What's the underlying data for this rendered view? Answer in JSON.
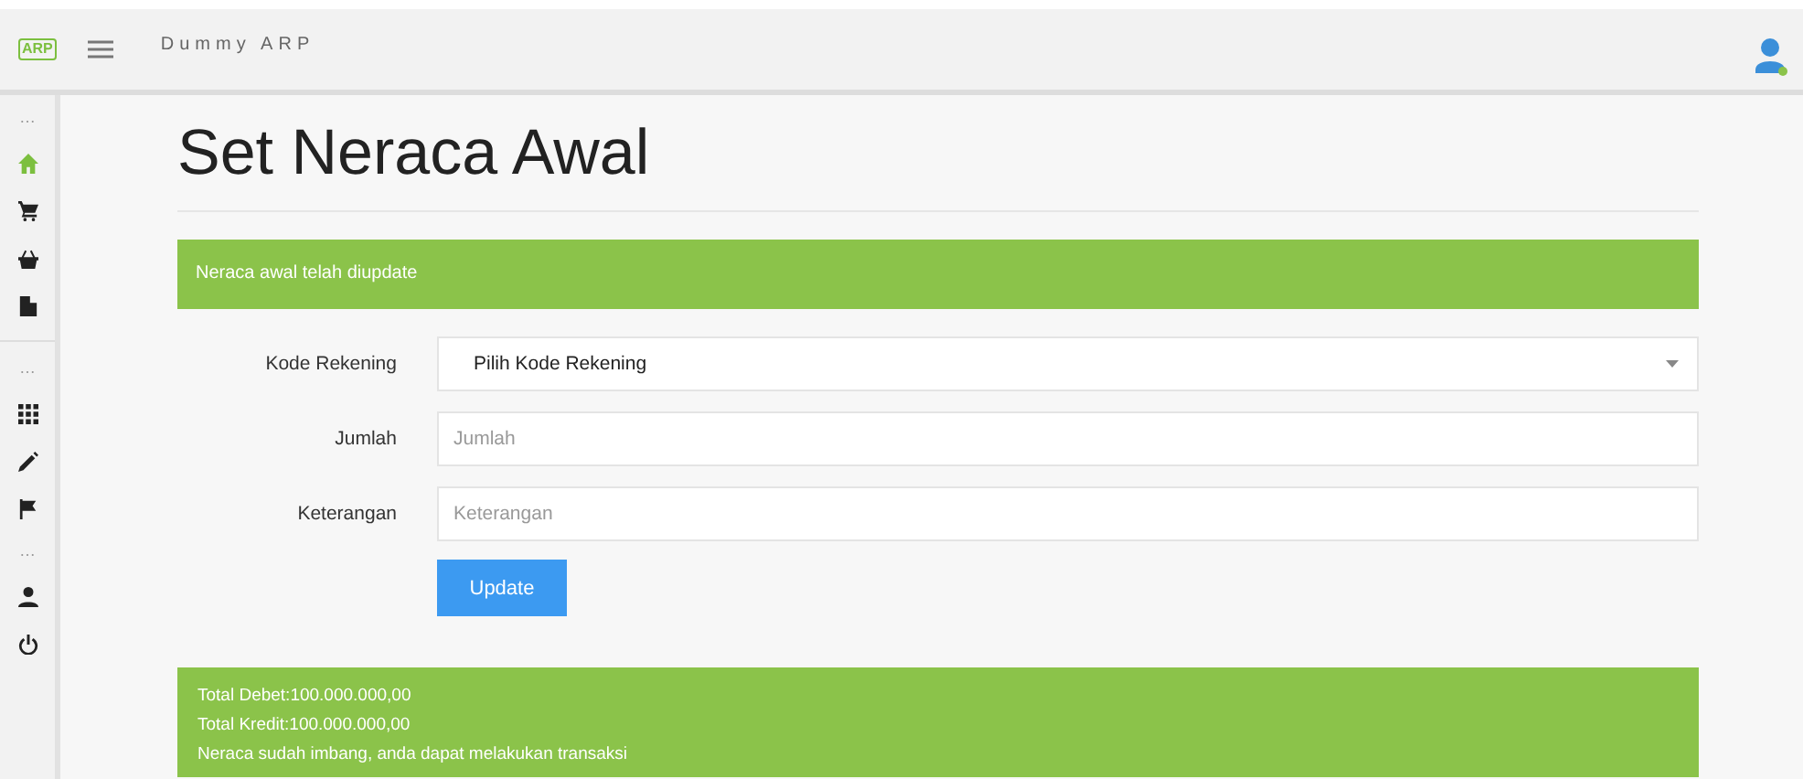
{
  "header": {
    "logo_text": "ARP",
    "app_name": "Dummy ARP",
    "user_online": true
  },
  "sidebar": {
    "items": [
      {
        "kind": "dots",
        "label": "…"
      },
      {
        "kind": "home",
        "selected": true
      },
      {
        "kind": "cart",
        "selected": false
      },
      {
        "kind": "basket",
        "selected": false
      },
      {
        "kind": "file",
        "selected": false
      },
      {
        "kind": "divider"
      },
      {
        "kind": "dots",
        "label": "…"
      },
      {
        "kind": "grid",
        "selected": false
      },
      {
        "kind": "pencil",
        "selected": false
      },
      {
        "kind": "flag",
        "selected": false
      },
      {
        "kind": "dots",
        "label": "…"
      },
      {
        "kind": "person",
        "selected": false
      },
      {
        "kind": "power",
        "selected": false
      }
    ]
  },
  "page": {
    "title": "Set Neraca Awal",
    "alert": "Neraca awal telah diupdate",
    "form": [
      {
        "kind": "select",
        "label": "Kode Rekening",
        "value": "Pilih Kode Rekening"
      },
      {
        "kind": "input",
        "label": "Jumlah",
        "placeholder": "Jumlah"
      },
      {
        "kind": "input",
        "label": "Keterangan",
        "placeholder": "Keterangan"
      }
    ],
    "button": "Update",
    "summary": [
      "Total Debet:100.000.000,00",
      "Total Kredit:100.000.000,00",
      "Neraca sudah imbang, anda dapat melakukan transaksi"
    ]
  }
}
